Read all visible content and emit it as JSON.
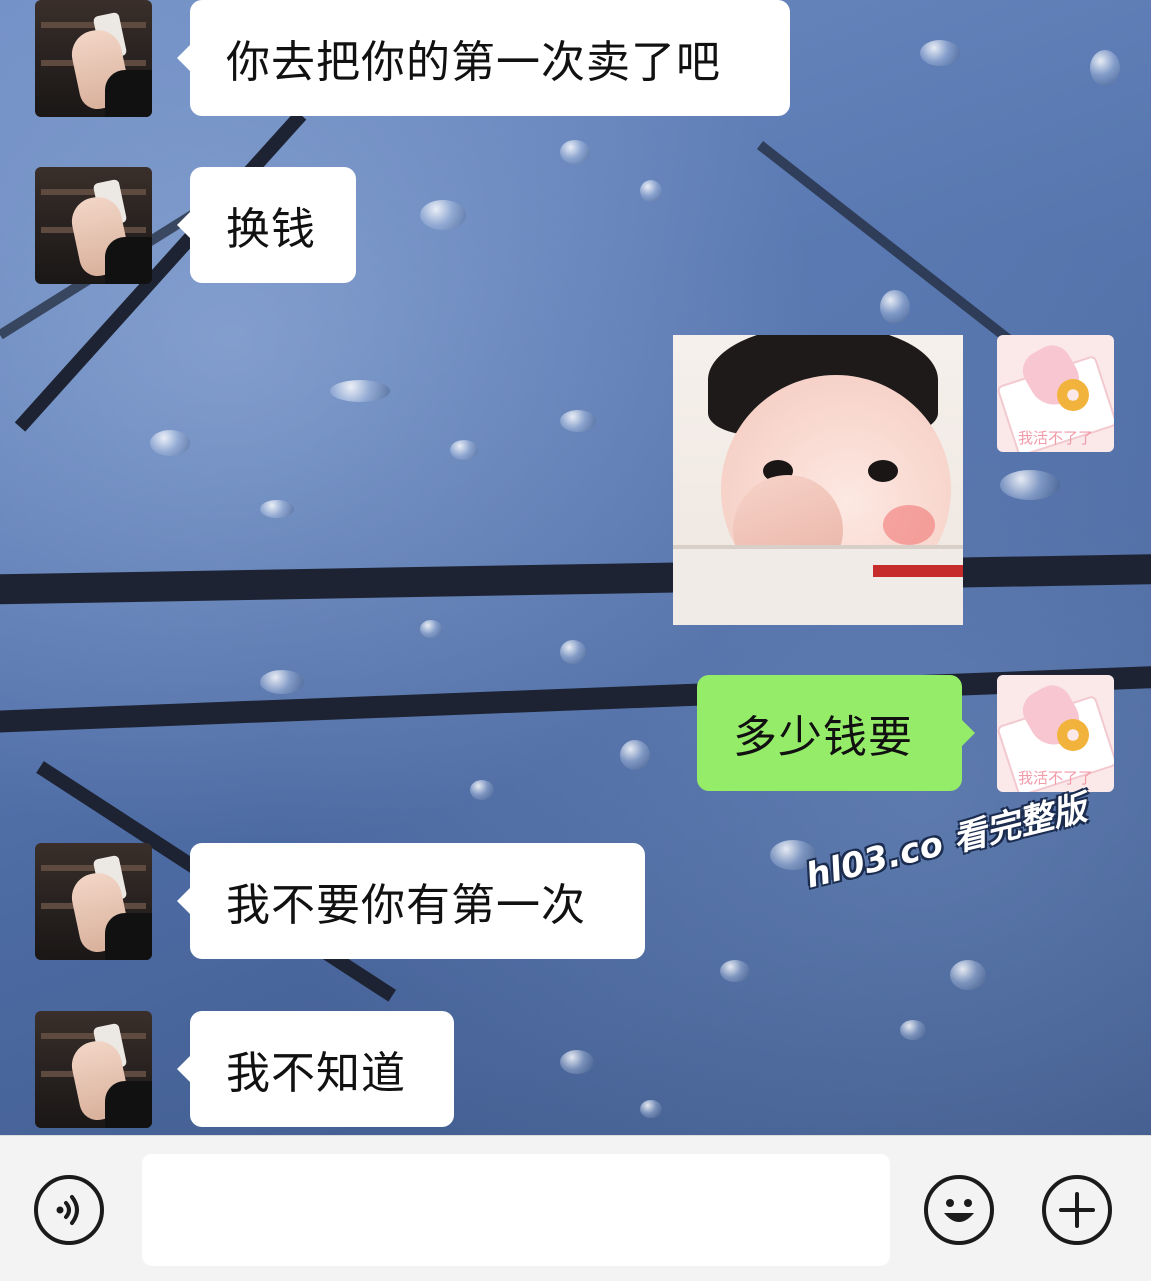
{
  "chat": {
    "messages": [
      {
        "side": "incoming",
        "type": "text",
        "text": "你去把你的第一次卖了吧"
      },
      {
        "side": "incoming",
        "type": "text",
        "text": "换钱"
      },
      {
        "side": "outgoing",
        "type": "sticker"
      },
      {
        "side": "outgoing",
        "type": "text",
        "text": "多少钱要"
      },
      {
        "side": "incoming",
        "type": "text",
        "text": "我不要你有第一次"
      },
      {
        "side": "incoming",
        "type": "text",
        "text": "我不知道"
      }
    ],
    "self_avatar_caption": "我活不了了"
  },
  "watermark": "hl03.co 看完整版",
  "input_bar": {
    "input_value": "",
    "icons": [
      "voice-icon",
      "emoji-icon",
      "plus-icon"
    ]
  },
  "colors": {
    "outgoing_bubble": "#95ec69",
    "incoming_bubble": "#ffffff",
    "input_bar_bg": "#f3f3f3"
  }
}
